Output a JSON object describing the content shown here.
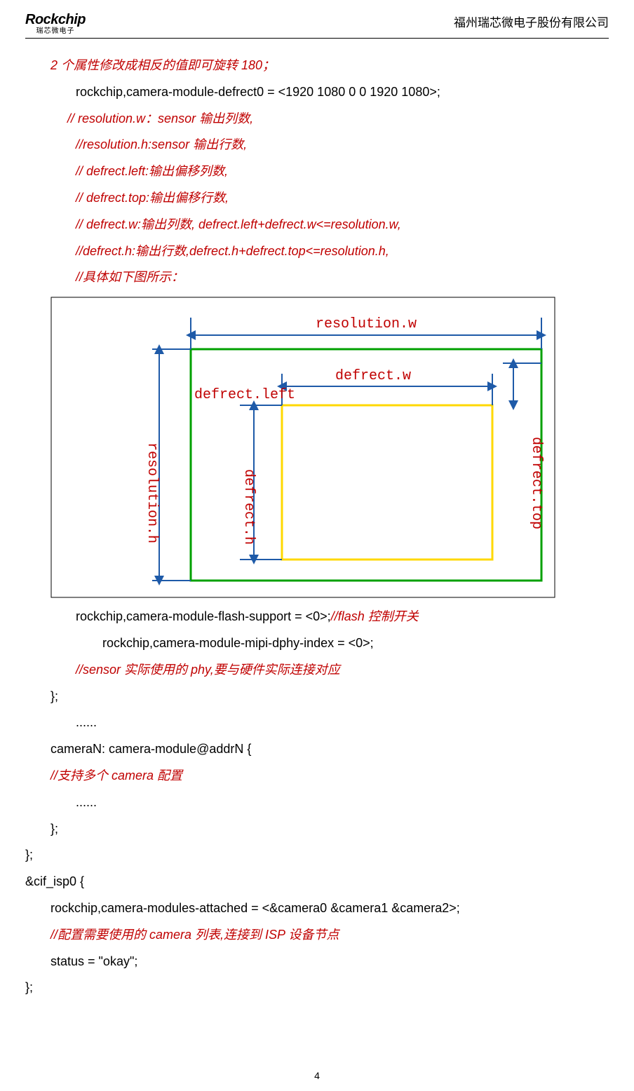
{
  "header": {
    "logo_main": "Rockchip",
    "logo_sub": "瑞芯微电子",
    "company": "福州瑞芯微电子股份有限公司"
  },
  "lines": {
    "l1": "2 个属性修改成相反的值即可旋转 180；",
    "l2": "rockchip,camera-module-defrect0 = <1920 1080 0 0 1920 1080>;",
    "l3": "// resolution.w：sensor 输出列数,",
    "l4": "//resolution.h:sensor 输出行数,",
    "l5": "// defrect.left:输出偏移列数,",
    "l6": "// defrect.top:输出偏移行数,",
    "l7": "// defrect.w:输出列数, defrect.left+defrect.w<=resolution.w,",
    "l8": "//defrect.h:输出行数,defrect.h+defrect.top<=resolution.h,",
    "l9": "//具体如下图所示：",
    "l10a": "rockchip,camera-module-flash-support = <0>;",
    "l10b": "//flash  控制开关",
    "l11": "rockchip,camera-module-mipi-dphy-index = <0>;",
    "l12": "//sensor 实际使用的 phy,要与硬件实际连接对应",
    "l13": "};",
    "l14": "......",
    "l15": "cameraN: camera-module@addrN {",
    "l16": "//支持多个 camera 配置",
    "l17": "......",
    "l18": "};",
    "l19": "};",
    "l20": "&cif_isp0 {",
    "l21": "rockchip,camera-modules-attached = <&camera0 &camera1 &camera2>;",
    "l22": "//配置需要使用的 camera 列表,连接到 ISP 设备节点",
    "l23": "status = \"okay\";",
    "l24": "};"
  },
  "diagram": {
    "resolution_w": "resolution.w",
    "resolution_h": "resolution.h",
    "defrect_w": "defrect.w",
    "defrect_h": "defrect.h",
    "defrect_left": "defrect.left",
    "defrect_top": "defrect.top"
  },
  "page_number": "4"
}
